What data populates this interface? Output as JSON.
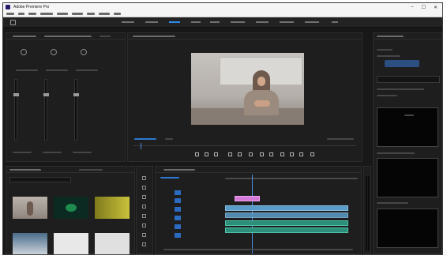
{
  "window": {
    "title": "Adobe Premiere Pro",
    "controls": [
      "–",
      "☐",
      "✕"
    ]
  },
  "program_monitor": {
    "video_description": "person in hijab seated in front of whiteboard"
  },
  "project_bin": {
    "thumbnail_count": 6
  },
  "colors": {
    "accent": "#2d8ceb",
    "panel": "#1e1e1e",
    "video_clip": "#5a9dc8",
    "audio_clip": "#2b8f7a",
    "title_clip": "#d67ad9"
  }
}
